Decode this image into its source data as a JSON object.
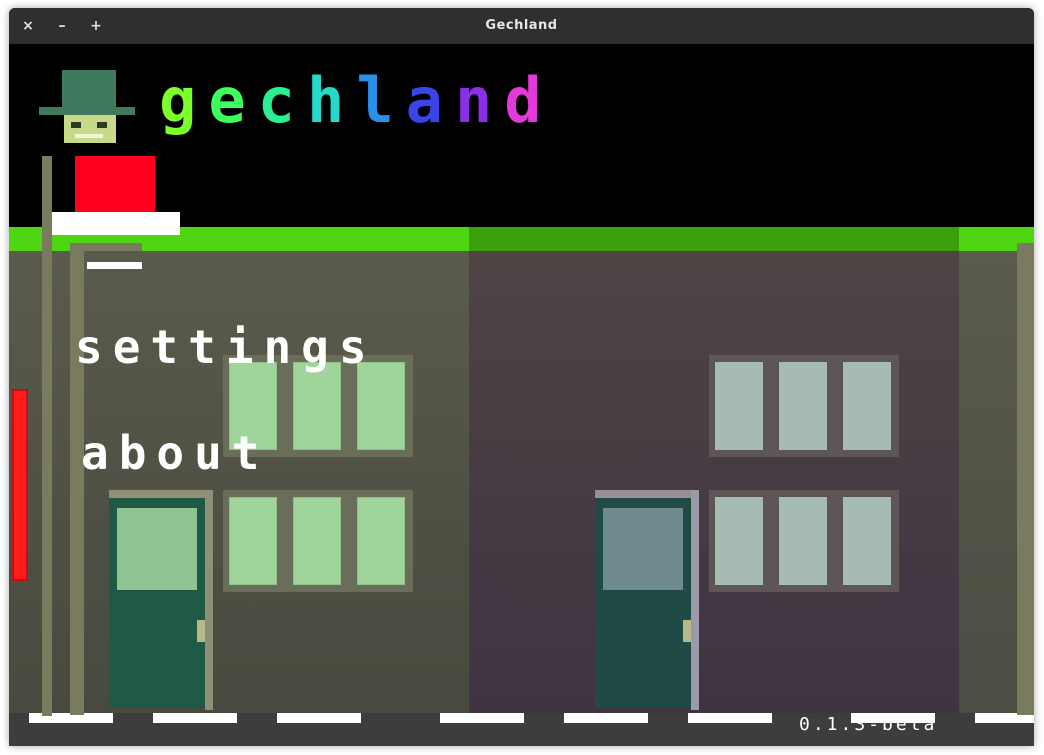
{
  "window": {
    "title": "Gechland",
    "buttons": {
      "close": "×",
      "minimize": "–",
      "maximize": "+"
    }
  },
  "game": {
    "logo_letters": [
      {
        "ch": "g",
        "color": "#7bff2a"
      },
      {
        "ch": "e",
        "color": "#3cff5c"
      },
      {
        "ch": "c",
        "color": "#2bf08f"
      },
      {
        "ch": "h",
        "color": "#25d9c9"
      },
      {
        "ch": "l",
        "color": "#2a8fe8"
      },
      {
        "ch": "a",
        "color": "#3a44e8"
      },
      {
        "ch": "n",
        "color": "#8a2ee8"
      },
      {
        "ch": "d",
        "color": "#e23ad9"
      }
    ],
    "menu": {
      "settings_label": "settings",
      "about_label": "about"
    },
    "version": "0.1.3-beta"
  },
  "colors": {
    "grass": "#4fd612",
    "road": "#3d3d3d",
    "hat": "#3f7a5c",
    "coat": "#ff0020",
    "sign": "#ff1c1c"
  },
  "icons": {
    "character": "pixel-character-icon"
  }
}
